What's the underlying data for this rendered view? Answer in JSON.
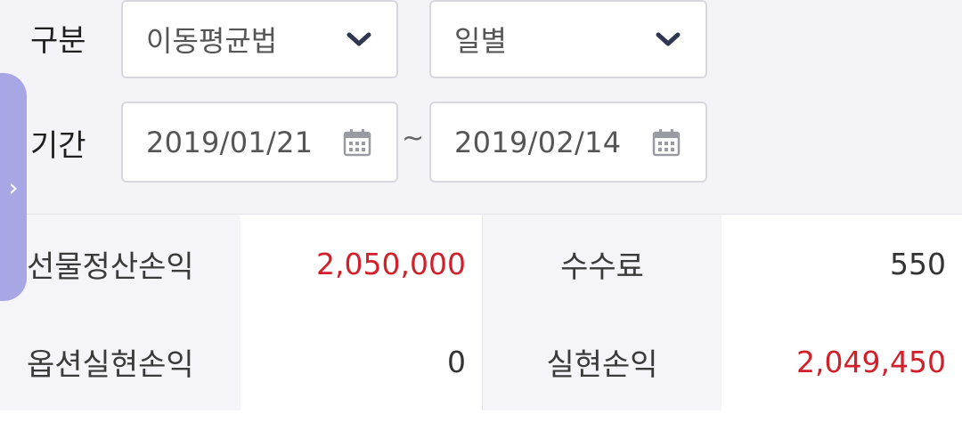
{
  "filters": {
    "category_label": "구분",
    "method_value": "이동평균법",
    "period_type_value": "일별",
    "period_label": "기간",
    "start_date": "2019/01/21",
    "separator": "~",
    "end_date": "2019/02/14"
  },
  "side_tab": {
    "glyph": "›"
  },
  "summary": {
    "futures_pl_label": "선물정산손익",
    "futures_pl_value": "2,050,000",
    "fee_label": "수수료",
    "fee_value": "550",
    "options_pl_label": "옵션실현손익",
    "options_pl_value": "0",
    "realized_pl_label": "실현손익",
    "realized_pl_value": "2,049,450"
  },
  "colors": {
    "positive": "#d1202a",
    "side_tab": "#a9a6e6",
    "filter_bg": "#f3f3f8"
  },
  "icons": {
    "dropdown": "chevron-down-icon",
    "date": "calendar-icon"
  }
}
